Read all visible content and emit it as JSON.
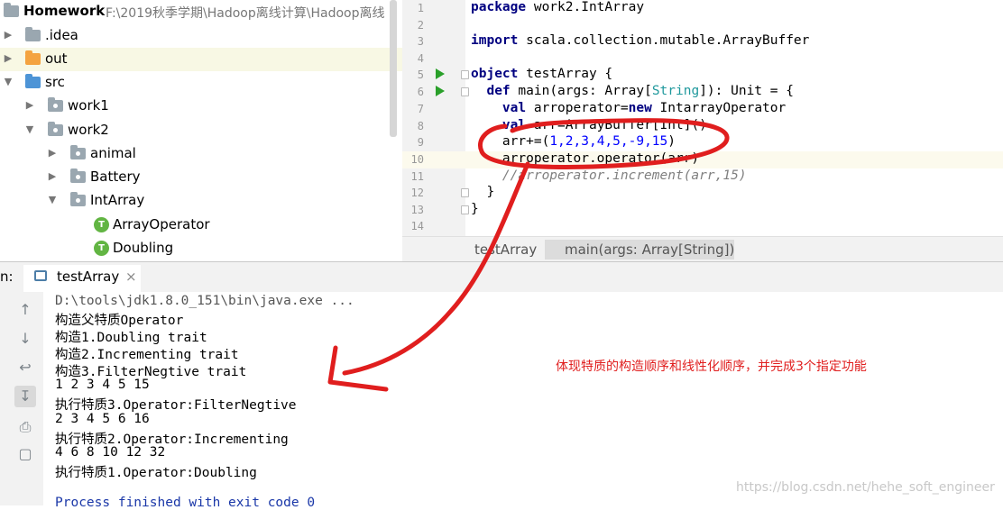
{
  "project": {
    "root_label": "Homework",
    "root_path": "F:\\2019秋季学期\\Hadoop离线计算\\Hadoop离线",
    "items": [
      {
        "label": ".idea"
      },
      {
        "label": "out"
      },
      {
        "label": "src"
      },
      {
        "label": "work1"
      },
      {
        "label": "work2"
      },
      {
        "label": "animal"
      },
      {
        "label": "Battery"
      },
      {
        "label": "IntArray"
      },
      {
        "label": "ArrayOperator"
      },
      {
        "label": "Doubling"
      }
    ],
    "trait_badge": "T"
  },
  "editor": {
    "line_numbers": [
      "1",
      "2",
      "3",
      "4",
      "5",
      "6",
      "7",
      "8",
      "9",
      "10",
      "11",
      "12",
      "13",
      "14"
    ],
    "code": {
      "l1_kw": "package",
      "l1_rest": " work2.IntArray",
      "l3_kw": "import",
      "l3_rest": " scala.collection.mutable.ArrayBuffer",
      "l5_kw": "object",
      "l5_rest": " testArray {",
      "l6_kw": "def",
      "l6_a": " main(args: Array[",
      "l6_ty": "String",
      "l6_b": "]): Unit = {",
      "l7_kw": "val",
      "l7_a": " arroperator=",
      "l7_kw2": "new",
      "l7_b": " IntarrayOperator",
      "l8_kw": "val",
      "l8_a": " arr=ArrayBuffer[Int]()",
      "l9_a": "arr+=(",
      "l9_nums": "1,2,3,4,5,-9,15",
      "l9_b": ")",
      "l10_a": "arroperator.operator(arr)",
      "l11_a": "//arroperator.increment(arr,15)",
      "l12_a": "}",
      "l13_a": "}"
    },
    "breadcrumbs": [
      "testArray",
      "main(args: Array[String])"
    ]
  },
  "run": {
    "label": "n:",
    "tab_label": "testArray",
    "tab_close": "×",
    "output": [
      "D:\\tools\\jdk1.8.0_151\\bin\\java.exe ...",
      "构造父特质Operator",
      "构造1.Doubling trait",
      "构造2.Incrementing trait",
      "构造3.FilterNegtive trait",
      "1 2 3 4 5 15",
      "执行特质3.Operator:FilterNegtive",
      "2 3 4 5 6 16",
      "执行特质2.Operator:Incrementing",
      "4 6 8 10 12 32",
      "执行特质1.Operator:Doubling",
      "",
      "Process finished with exit code 0"
    ],
    "tools": [
      "rerun-icon",
      "up-icon",
      "down-icon",
      "wrap-icon",
      "scroll-end-icon",
      "print-icon",
      "trash-icon"
    ]
  },
  "annotation": "体现特质的构造顺序和线性化顺序，并完成3个指定功能",
  "watermark": "https://blog.csdn.net/hehe_soft_engineer",
  "colors": {
    "annotation_red": "#e01e1e",
    "keyword": "#000080",
    "type": "#20999d",
    "number": "#0000ff",
    "run_green": "#2aa02a"
  }
}
